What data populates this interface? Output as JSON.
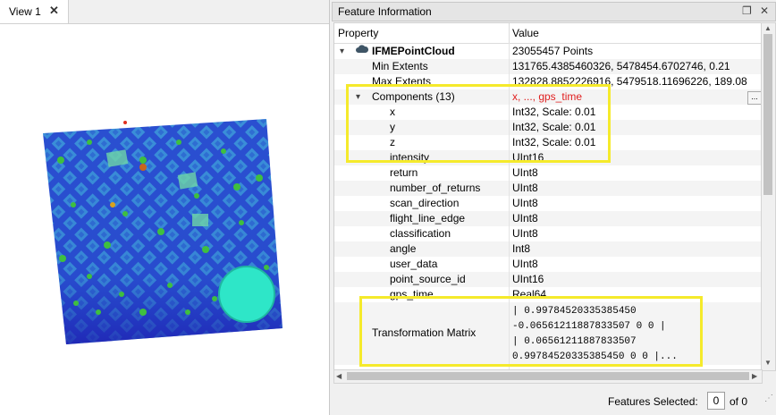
{
  "view": {
    "tab_label": "View 1",
    "close_glyph": "✕"
  },
  "info_panel": {
    "title": "Feature Information",
    "float_glyph": "❐",
    "close_glyph": "✕",
    "columns": {
      "property": "Property",
      "value": "Value"
    },
    "rows": [
      {
        "property": "IFMEPointCloud",
        "value": "23055457 Points"
      },
      {
        "property": "Min Extents",
        "value": "131765.4385460326, 5478454.6702746, 0.21"
      },
      {
        "property": "Max Extents",
        "value": "132828.8852226916, 5479518.11696226, 189.08"
      },
      {
        "property": "Components (13)",
        "value": "x, ..., gps_time"
      },
      {
        "property": "x",
        "value": "Int32, Scale: 0.01"
      },
      {
        "property": "y",
        "value": "Int32, Scale: 0.01"
      },
      {
        "property": "z",
        "value": "Int32, Scale: 0.01"
      },
      {
        "property": "intensity",
        "value": "UInt16"
      },
      {
        "property": "return",
        "value": "UInt8"
      },
      {
        "property": "number_of_returns",
        "value": "UInt8"
      },
      {
        "property": "scan_direction",
        "value": "UInt8"
      },
      {
        "property": "flight_line_edge",
        "value": "UInt8"
      },
      {
        "property": "classification",
        "value": "UInt8"
      },
      {
        "property": "angle",
        "value": "Int8"
      },
      {
        "property": "user_data",
        "value": "UInt8"
      },
      {
        "property": "point_source_id",
        "value": "UInt16"
      },
      {
        "property": "gps_time",
        "value": "Real64"
      },
      {
        "property": "Transformation Matrix",
        "value_lines": [
          "| 0.99784520335385450",
          "-0.06561211887833507 0 0 |",
          "| 0.06561211887833507",
          "0.99784520335385450 0 0 |..."
        ]
      }
    ],
    "ellipsis_label": "..."
  },
  "footer": {
    "features_selected_label": "Features Selected:",
    "selected_value": "0",
    "of_text": "of 0"
  },
  "colors": {
    "highlight_box": "#f5ea2b",
    "components_value": "#e02020"
  }
}
